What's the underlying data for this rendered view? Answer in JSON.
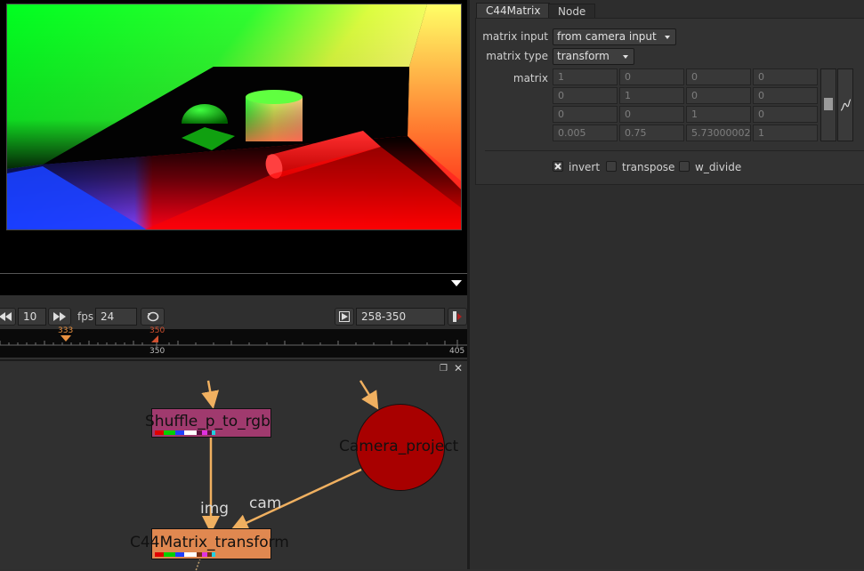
{
  "properties": {
    "tabs": [
      {
        "label": "C44Matrix"
      },
      {
        "label": "Node"
      }
    ],
    "matrix_input": {
      "label": "matrix input",
      "value": "from camera input"
    },
    "matrix_type": {
      "label": "matrix type",
      "value": "transform"
    },
    "matrix_label": "matrix",
    "matrix_rows": [
      [
        "1",
        "0",
        "0",
        "0"
      ],
      [
        "0",
        "1",
        "0",
        "0"
      ],
      [
        "0",
        "0",
        "1",
        "0"
      ],
      [
        "0.005",
        "0.75",
        "5.73000002",
        "1"
      ]
    ],
    "checkboxes": [
      {
        "label": "invert",
        "checked": true
      },
      {
        "label": "transpose",
        "checked": false
      },
      {
        "label": "w_divide",
        "checked": false
      }
    ]
  },
  "playback": {
    "frame_increment": "10",
    "fps_label": "fps",
    "fps_value": "24",
    "frame_range": "258-350"
  },
  "timeline": {
    "current_frame_marker": "333",
    "out_marker": "350",
    "tick_350": "350",
    "tick_405": "405"
  },
  "nodegraph": {
    "nodes": {
      "shuffle": {
        "label": "Shuffle_p_to_rgb",
        "color": "#a03a6e"
      },
      "camera": {
        "label": "Camera_project",
        "color": "#a80000"
      },
      "c44": {
        "label": "C44Matrix_transform",
        "color": "#e08850"
      }
    },
    "edge_labels": {
      "img": "img",
      "cam": "cam"
    }
  },
  "colors": {
    "edge": "#f0b060",
    "panel_bg": "#2d2d2d",
    "viewer_bg": "#000000"
  }
}
